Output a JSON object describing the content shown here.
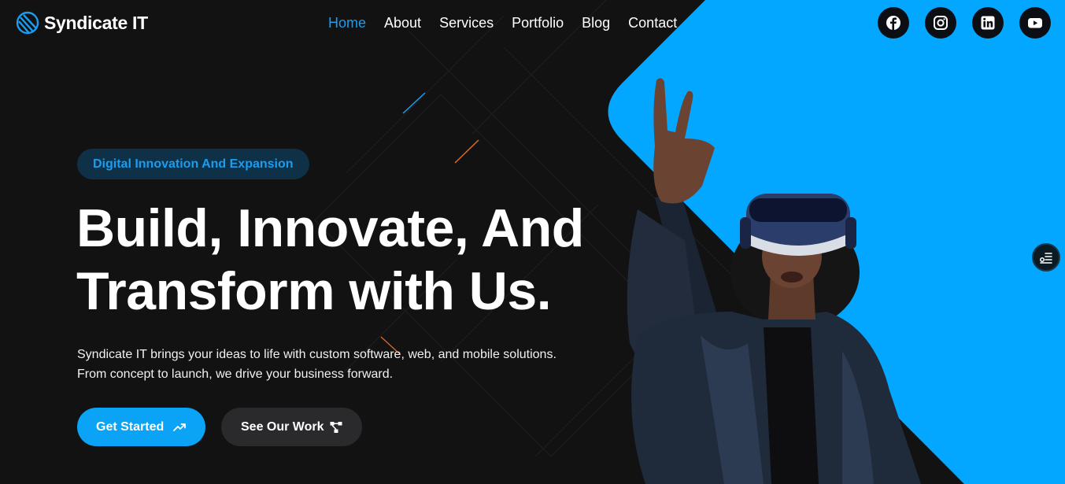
{
  "brand": {
    "name": "Syndicate IT",
    "logo_icon": "logo-stripes-icon"
  },
  "nav": {
    "items": [
      {
        "label": "Home",
        "active": true
      },
      {
        "label": "About",
        "active": false
      },
      {
        "label": "Services",
        "active": false
      },
      {
        "label": "Portfolio",
        "active": false
      },
      {
        "label": "Blog",
        "active": false
      },
      {
        "label": "Contact",
        "active": false
      }
    ]
  },
  "socials": [
    {
      "icon": "facebook-icon"
    },
    {
      "icon": "instagram-icon"
    },
    {
      "icon": "linkedin-icon"
    },
    {
      "icon": "youtube-icon"
    }
  ],
  "hero": {
    "tagline": "Digital Innovation And Expansion",
    "headline_line1": "Build, Innovate, And",
    "headline_line2": "Transform with Us.",
    "desc_line1": "Syndicate IT brings your ideas to life with custom software, web, and mobile solutions.",
    "desc_line2": "From concept to launch, we drive your business forward.",
    "primary_button": "Get Started",
    "secondary_button": "See Our Work"
  },
  "colors": {
    "background": "#121212",
    "accent": "#0ba3f6",
    "nav_active": "#1a9cf0"
  }
}
